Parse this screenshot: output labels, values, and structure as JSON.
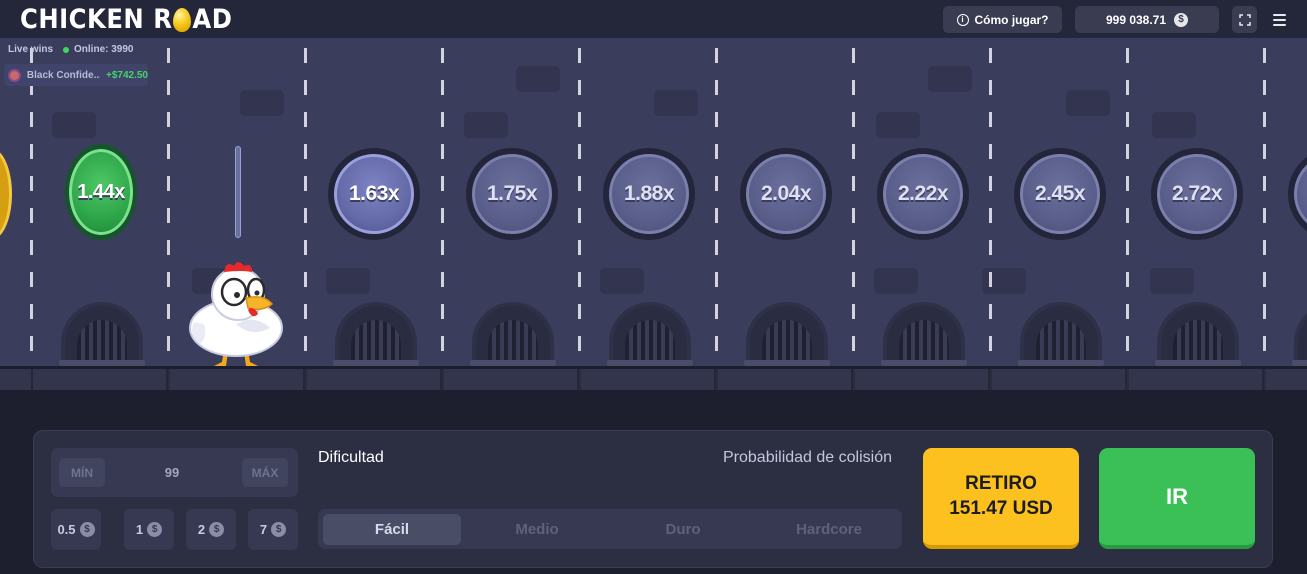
{
  "header": {
    "logo_text_left": "CHICKEN R",
    "logo_text_right": "AD",
    "how_to_play": "Cómo jugar?",
    "balance": "999 038.71",
    "currency_symbol": "$"
  },
  "live": {
    "title": "Live wins",
    "online": "Online: 3990",
    "wins": [
      {
        "name": "Black Confide...",
        "amount": "+$742.50"
      }
    ]
  },
  "multipliers": {
    "won": "1.44x",
    "current": "1.63x",
    "upcoming": [
      "1.75x",
      "1.88x",
      "2.04x",
      "2.22x",
      "2.45x",
      "2.72x"
    ]
  },
  "controls": {
    "min_label": "MÍN",
    "max_label": "MÁX",
    "bet_value": "99",
    "chips": [
      "0.5",
      "1",
      "2",
      "7"
    ],
    "chip_currency": "$",
    "difficulty_label": "Dificultad",
    "collision_label": "Probabilidad de colisión",
    "difficulties": [
      "Fácil",
      "Medio",
      "Duro",
      "Hardcore"
    ],
    "selected_difficulty": "Fácil",
    "cashout_line1": "RETIRO",
    "cashout_line2": "151.47 USD",
    "go_label": "IR"
  },
  "colors": {
    "accent_yellow": "#fcc11f",
    "accent_green": "#3bbf57",
    "panel": "#2c2e42"
  }
}
